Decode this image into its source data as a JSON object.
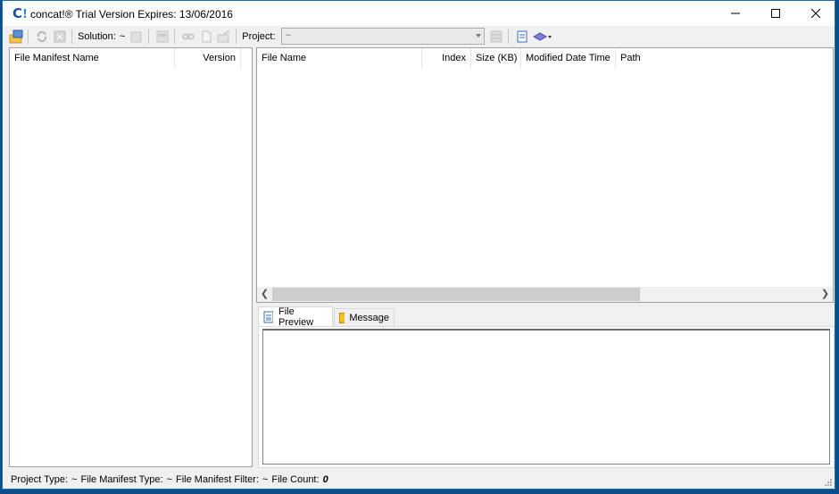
{
  "window": {
    "app_name": "concat!®",
    "title": "concat!® Trial Version Expires: 13/06/2016",
    "controls": {
      "minimize": "minimize",
      "maximize": "maximize",
      "close": "close"
    }
  },
  "toolbar": {
    "solution_label": "Solution:",
    "solution_value": "~",
    "project_label": "Project:",
    "project_value": "~",
    "icons": [
      "open-folder-icon",
      "refresh-icon",
      "close-solution-icon",
      "edit-icon",
      "properties-icon",
      "link-icon",
      "new-file-icon",
      "export-folder-icon",
      "list-icon",
      "document-icon",
      "layers-dropdown-icon"
    ]
  },
  "left_panel": {
    "columns": [
      {
        "label": "File Manifest Name"
      },
      {
        "label": "Version"
      }
    ],
    "rows": []
  },
  "right_panel": {
    "columns": [
      {
        "label": "File Name"
      },
      {
        "label": "Index"
      },
      {
        "label": "Size (KB)"
      },
      {
        "label": "Modified Date Time"
      },
      {
        "label": "Path"
      }
    ],
    "rows": []
  },
  "bottom_tabs": [
    {
      "label": "File Preview",
      "icon": "document-icon",
      "active": true
    },
    {
      "label": "Message",
      "icon": "message-icon",
      "active": false
    }
  ],
  "status_bar": {
    "project_type_label": "Project Type:",
    "project_type_value": "~",
    "file_manifest_type_label": "File Manifest Type:",
    "file_manifest_type_value": "~",
    "file_manifest_filter_label": "File Manifest Filter:",
    "file_manifest_filter_value": "~",
    "file_count_label": "File Count:",
    "file_count_value": "0"
  }
}
